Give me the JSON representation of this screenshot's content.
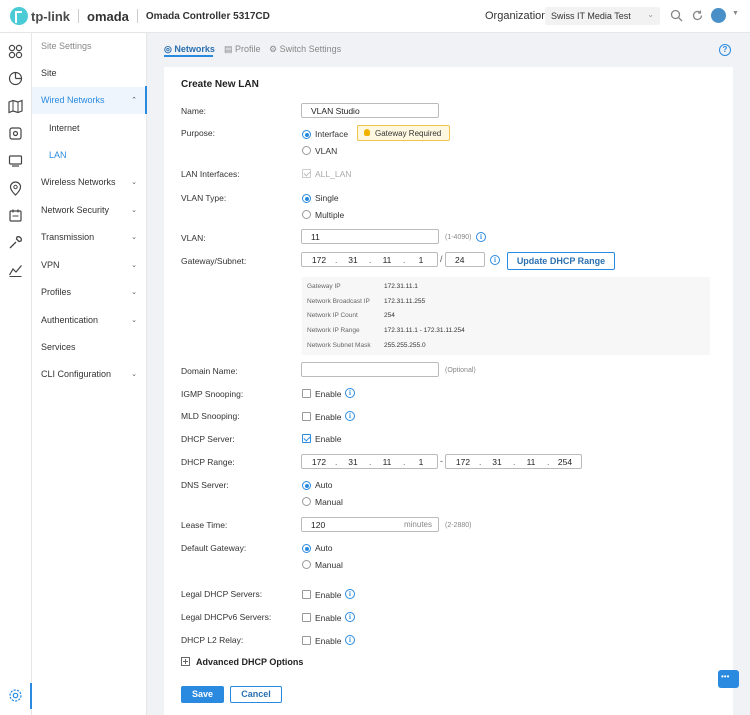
{
  "header": {
    "brand": "tp-link",
    "product": "omada",
    "controller": "Omada Controller  5317CD",
    "org_label": "Organization:",
    "org_value": "Swiss IT Media Test"
  },
  "sidebar": {
    "items": [
      {
        "label": "Site Settings"
      },
      {
        "label": "Site"
      },
      {
        "label": "Wired Networks"
      },
      {
        "label": "Internet"
      },
      {
        "label": "LAN"
      },
      {
        "label": "Wireless Networks"
      },
      {
        "label": "Network Security"
      },
      {
        "label": "Transmission"
      },
      {
        "label": "VPN"
      },
      {
        "label": "Profiles"
      },
      {
        "label": "Authentication"
      },
      {
        "label": "Services"
      },
      {
        "label": "CLI Configuration"
      }
    ]
  },
  "tabs": [
    {
      "label": "Networks"
    },
    {
      "label": "Profile"
    },
    {
      "label": "Switch Settings"
    }
  ],
  "form": {
    "title": "Create New LAN",
    "name_label": "Name:",
    "name_value": "VLAN Studio",
    "purpose_label": "Purpose:",
    "purpose_interface": "Interface",
    "purpose_vlan": "VLAN",
    "gateway_badge": "Gateway Required",
    "lan_interfaces_label": "LAN Interfaces:",
    "lan_interfaces_value": "ALL_LAN",
    "vlan_type_label": "VLAN Type:",
    "vlan_type_single": "Single",
    "vlan_type_multiple": "Multiple",
    "vlan_label": "VLAN:",
    "vlan_value": "11",
    "vlan_hint": "(1-4090)",
    "gateway_label": "Gateway/Subnet:",
    "gateway_ip": [
      "172",
      "31",
      "11",
      "1"
    ],
    "gateway_mask": "24",
    "update_dhcp_button": "Update DHCP Range",
    "info": [
      {
        "k": "Gateway IP",
        "v": "172.31.11.1"
      },
      {
        "k": "Network Broadcast IP",
        "v": "172.31.11.255"
      },
      {
        "k": "Network IP Count",
        "v": "254"
      },
      {
        "k": "Network IP Range",
        "v": "172.31.11.1 - 172.31.11.254"
      },
      {
        "k": "Network Subnet Mask",
        "v": "255.255.255.0"
      }
    ],
    "domain_label": "Domain Name:",
    "domain_value": "",
    "domain_hint": "(Optional)",
    "igmp_label": "IGMP Snooping:",
    "mld_label": "MLD Snooping:",
    "dhcp_server_label": "DHCP Server:",
    "enable": "Enable",
    "dhcp_range_label": "DHCP Range:",
    "dhcp_start": [
      "172",
      "31",
      "11",
      "1"
    ],
    "dhcp_end": [
      "172",
      "31",
      "11",
      "254"
    ],
    "dhcp_range_sep": "-",
    "dns_label": "DNS Server:",
    "auto": "Auto",
    "manual": "Manual",
    "lease_label": "Lease Time:",
    "lease_value": "120",
    "lease_unit": "minutes",
    "lease_hint": "(2-2880)",
    "default_gw_label": "Default Gateway:",
    "legal_dhcp_label": "Legal DHCP Servers:",
    "legal_dhcpv6_label": "Legal DHCPv6 Servers:",
    "l2_relay_label": "DHCP L2 Relay:",
    "advanced_label": "Advanced DHCP Options",
    "save_label": "Save",
    "cancel_label": "Cancel"
  },
  "colors": {
    "accent": "#2a8ae0",
    "badge_bg": "#fff8e1",
    "badge_border": "#f2c44c"
  }
}
